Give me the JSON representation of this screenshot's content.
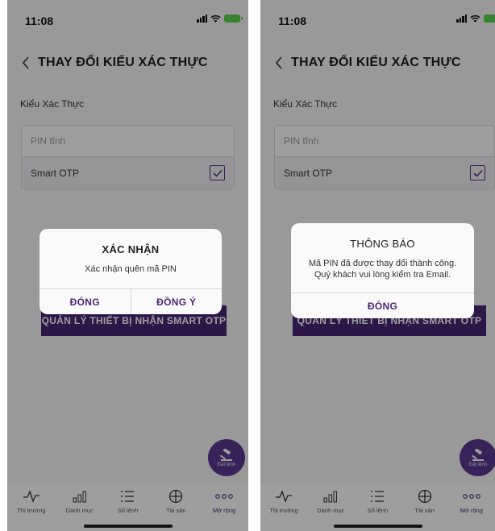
{
  "left": {
    "status_time": "11:08",
    "title": "THAY ĐỔI KIỂU XÁC THỰC",
    "section_label": "Kiểu Xác Thực",
    "options": [
      {
        "label": "PIN tĩnh",
        "checked": false
      },
      {
        "label": "Smart OTP",
        "checked": true
      }
    ],
    "manage_button": "QUẢN LÝ THIẾT BỊ NHẬN SMART OTP",
    "dialog": {
      "title": "XÁC NHẬN",
      "message": "Xác nhận quên mã PIN",
      "buttons": [
        "ĐÓNG",
        "ĐỒNG Ý"
      ]
    },
    "fab_label": "Đặt lệnh",
    "tabs": [
      {
        "label": "Thị trường",
        "icon": "chart-line-icon"
      },
      {
        "label": "Danh mục",
        "icon": "bar-chart-icon"
      },
      {
        "label": "Sổ lệnh",
        "icon": "list-icon"
      },
      {
        "label": "Tài sản",
        "icon": "asset-icon"
      },
      {
        "label": "Mở rộng",
        "icon": "more-icon",
        "active": true
      }
    ]
  },
  "right": {
    "status_time": "11:08",
    "title": "THAY ĐỔI KIỂU XÁC THỰC",
    "section_label": "Kiểu Xác Thực",
    "options": [
      {
        "label": "PIN tĩnh",
        "checked": false
      },
      {
        "label": "Smart OTP",
        "checked": true
      }
    ],
    "manage_button": "QUẢN LÝ THIẾT BỊ NHẬN SMART OTP",
    "dialog": {
      "title": "THÔNG BÁO",
      "message_line1": "Mã PIN đã được thay đổi thành công.",
      "message_line2": "Quý khách vui lòng kiểm tra Email.",
      "buttons": [
        "ĐÓNG"
      ]
    },
    "fab_label": "Đặt lệnh",
    "tabs": [
      {
        "label": "Thị trường",
        "icon": "chart-line-icon"
      },
      {
        "label": "Danh mục",
        "icon": "bar-chart-icon"
      },
      {
        "label": "Sổ lệnh",
        "icon": "list-icon"
      },
      {
        "label": "Tài sản",
        "icon": "asset-icon"
      },
      {
        "label": "Mở rộng",
        "icon": "more-icon",
        "active": true
      }
    ]
  },
  "colors": {
    "brand_purple": "#4a2574",
    "fab_purple": "#5b3790",
    "battery_green": "#58d34c"
  }
}
